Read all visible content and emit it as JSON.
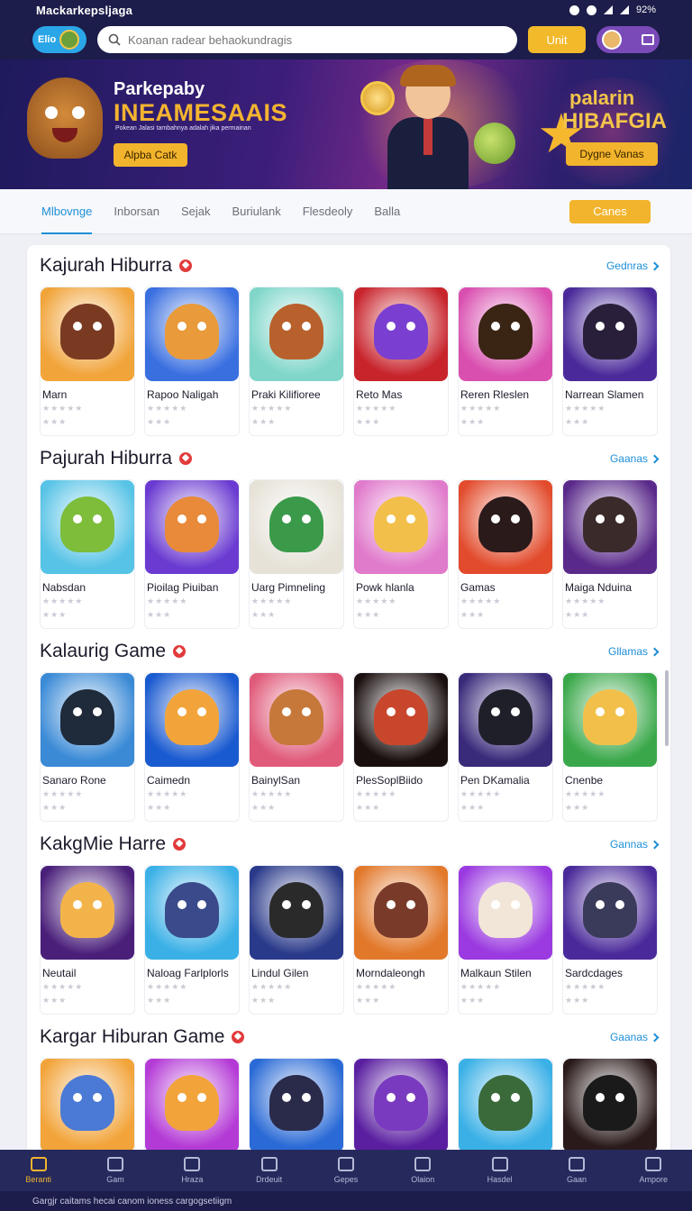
{
  "status": {
    "app_name": "Mackarkepsljaga",
    "battery": "92%"
  },
  "header": {
    "logo_text": "Elio",
    "search_placeholder": "Koanan radear behaokundragis",
    "unit_button": "Unit"
  },
  "banner": {
    "title_line1": "Parkepaby",
    "title_line2": "INEAMESAAIS",
    "subline": "Pokean Jalasi tambahnya adalah jika permainan",
    "left_button": "Alpba Catk",
    "right_title_line1": "palarin",
    "right_title_line2": "HIBAFGIA",
    "right_button": "Dygne Vanas"
  },
  "tabs": {
    "items": [
      "Mlbovnge",
      "Inborsan",
      "Sejak",
      "Buriulank",
      "Flesdeoly",
      "Balla"
    ],
    "cta": "Canes"
  },
  "sections": [
    {
      "title": "Kajurah Hiburra",
      "see_all": "Gednras",
      "games": [
        {
          "name": "Marn",
          "color": "#f1a43a",
          "char": "#7a3a22"
        },
        {
          "name": "Rapoo Naligah",
          "color": "#3a6fe0",
          "char": "#e99a3a"
        },
        {
          "name": "Praki Kilifioree",
          "color": "#7fd6c9",
          "char": "#b9612c"
        },
        {
          "name": "Reto Mas",
          "color": "#c8242c",
          "char": "#7a3fd1"
        },
        {
          "name": "Reren Rleslen",
          "color": "#d94fb0",
          "char": "#3a2414"
        },
        {
          "name": "Narrean Slamen",
          "color": "#4a2a9a",
          "char": "#2a1f3a"
        }
      ]
    },
    {
      "title": "Pajurah Hiburra",
      "see_all": "Gaanas",
      "games": [
        {
          "name": "Nabsdan",
          "color": "#57c3e6",
          "char": "#7dbd3a"
        },
        {
          "name": "Pioilag Piuiban",
          "color": "#6a3ad1",
          "char": "#e88a3a"
        },
        {
          "name": "Uarg Pimneling",
          "color": "#e6e2d8",
          "char": "#3a9a4a"
        },
        {
          "name": "Powk hlanla",
          "color": "#e07acb",
          "char": "#f2c04a"
        },
        {
          "name": "Gamas",
          "color": "#e24b2c",
          "char": "#2a1a1a"
        },
        {
          "name": "Maiga Nduina",
          "color": "#5a2a8a",
          "char": "#3a2a2a"
        }
      ]
    },
    {
      "title": "Kalaurig Game",
      "see_all": "Gllamas",
      "games": [
        {
          "name": "Sanaro Rone",
          "color": "#3a8ad6",
          "char": "#1f2a3a"
        },
        {
          "name": "Caimedn",
          "color": "#1a5ad0",
          "char": "#f2a43a"
        },
        {
          "name": "BainylSan",
          "color": "#e05a7a",
          "char": "#c6783a"
        },
        {
          "name": "PlesSoplBiido",
          "color": "#1a0f0f",
          "char": "#c8462c"
        },
        {
          "name": "Pen DKamalia",
          "color": "#3a2a7a",
          "char": "#1f1f2a"
        },
        {
          "name": "Cnenbe",
          "color": "#3aa84a",
          "char": "#f2c04a"
        }
      ]
    },
    {
      "title": "KakgMie Harre",
      "see_all": "Gannas",
      "games": [
        {
          "name": "Neutail",
          "color": "#4a1f7a",
          "char": "#f2b44a"
        },
        {
          "name": "Naloag Farlplorls",
          "color": "#3ab0e6",
          "char": "#3a4a8a"
        },
        {
          "name": "Lindul Gilen",
          "color": "#2a3a8a",
          "char": "#2a2a2a"
        },
        {
          "name": "Morndaleongh",
          "color": "#e2782a",
          "char": "#7a3a2a"
        },
        {
          "name": "Malkaun Stilen",
          "color": "#9a3ae0",
          "char": "#f2e6d8"
        },
        {
          "name": "Sardcdages",
          "color": "#4a2a9a",
          "char": "#3a3a5a"
        }
      ]
    },
    {
      "title": "Kargar Hiburan Game",
      "see_all": "Gaanas",
      "games": [
        {
          "name": "",
          "color": "#f2a43a",
          "char": "#4a7ad6"
        },
        {
          "name": "",
          "color": "#b43ad6",
          "char": "#f2a43a"
        },
        {
          "name": "",
          "color": "#2a6ad6",
          "char": "#2a2a4a"
        },
        {
          "name": "",
          "color": "#5a1fa0",
          "char": "#7a3ac0"
        },
        {
          "name": "",
          "color": "#3ab0e6",
          "char": "#3a6a3a"
        },
        {
          "name": "",
          "color": "#2a1a1a",
          "char": "#1a1a1a"
        }
      ]
    }
  ],
  "bottom_nav": {
    "items": [
      "Beranti",
      "Gam",
      "Hraza",
      "Drdeuit",
      "Gepes",
      "Olaion",
      "Hasdel",
      "Gaan",
      "Ampore"
    ],
    "active_index": 0
  },
  "footer": {
    "text": "Gargjr caitams hecai canom ioness cargogsetiigm"
  }
}
